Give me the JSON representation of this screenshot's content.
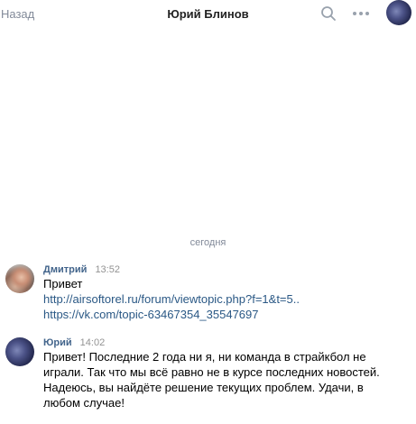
{
  "header": {
    "back_label": "Назад",
    "title": "Юрий Блинов",
    "search_icon": "search-icon",
    "more_icon": "more-horizontal-icon"
  },
  "date_separator": "сегодня",
  "messages": [
    {
      "author": "Дмитрий",
      "time": "13:52",
      "text": "Привет",
      "links": [
        "http://airsoftorel.ru/forum/viewtopic.php?f=1&t=5..",
        "https://vk.com/topic-63467354_35547697"
      ]
    },
    {
      "author": "Юрий",
      "time": "14:02",
      "lines": [
        "Привет! Последние 2 года ни я, ни команда в страйкбол не",
        "играли. Так что мы всё равно не в курсе последних новостей.",
        "Надеюсь, вы найдёте решение текущих проблем. Удачи, в",
        "любом случае!"
      ]
    }
  ],
  "colors": {
    "link": "#2a5885",
    "author": "#42648b",
    "muted": "#828a99",
    "time": "#939393"
  }
}
